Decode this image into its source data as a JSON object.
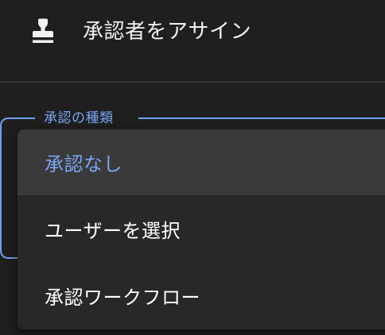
{
  "assign_action": {
    "label": "承認者をアサイン",
    "icon": "stamp-icon"
  },
  "approval_type_field": {
    "legend": "承認の種類",
    "accent_color": "#7aa5f3"
  },
  "dropdown": {
    "options": [
      {
        "label": "承認なし",
        "selected": true
      },
      {
        "label": "ユーザーを選択",
        "selected": false
      },
      {
        "label": "承認ワークフロー",
        "selected": false
      }
    ]
  }
}
